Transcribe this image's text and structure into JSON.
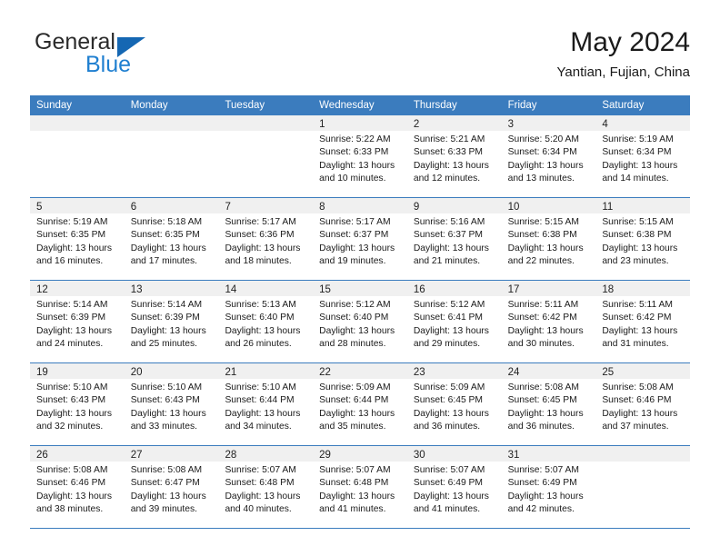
{
  "brand": {
    "name_part1": "General",
    "name_part2": "Blue",
    "logo_icon": "triangle-logo-icon"
  },
  "header": {
    "title": "May 2024",
    "subtitle": "Yantian, Fujian, China"
  },
  "colors": {
    "header_blue": "#3b7cbe",
    "brand_blue": "#1f7fd0",
    "logo_blue": "#1567b3",
    "date_band": "#f0f0f0",
    "text": "#1a1a1a",
    "header_text": "#ffffff"
  },
  "weekdays": [
    "Sunday",
    "Monday",
    "Tuesday",
    "Wednesday",
    "Thursday",
    "Friday",
    "Saturday"
  ],
  "weeks": [
    [
      {
        "date": "",
        "empty": true,
        "sunrise": "",
        "sunset": "",
        "daylight1": "",
        "daylight2": ""
      },
      {
        "date": "",
        "empty": true,
        "sunrise": "",
        "sunset": "",
        "daylight1": "",
        "daylight2": ""
      },
      {
        "date": "",
        "empty": true,
        "sunrise": "",
        "sunset": "",
        "daylight1": "",
        "daylight2": ""
      },
      {
        "date": "1",
        "empty": false,
        "sunrise": "Sunrise: 5:22 AM",
        "sunset": "Sunset: 6:33 PM",
        "daylight1": "Daylight: 13 hours",
        "daylight2": "and 10 minutes."
      },
      {
        "date": "2",
        "empty": false,
        "sunrise": "Sunrise: 5:21 AM",
        "sunset": "Sunset: 6:33 PM",
        "daylight1": "Daylight: 13 hours",
        "daylight2": "and 12 minutes."
      },
      {
        "date": "3",
        "empty": false,
        "sunrise": "Sunrise: 5:20 AM",
        "sunset": "Sunset: 6:34 PM",
        "daylight1": "Daylight: 13 hours",
        "daylight2": "and 13 minutes."
      },
      {
        "date": "4",
        "empty": false,
        "sunrise": "Sunrise: 5:19 AM",
        "sunset": "Sunset: 6:34 PM",
        "daylight1": "Daylight: 13 hours",
        "daylight2": "and 14 minutes."
      }
    ],
    [
      {
        "date": "5",
        "empty": false,
        "sunrise": "Sunrise: 5:19 AM",
        "sunset": "Sunset: 6:35 PM",
        "daylight1": "Daylight: 13 hours",
        "daylight2": "and 16 minutes."
      },
      {
        "date": "6",
        "empty": false,
        "sunrise": "Sunrise: 5:18 AM",
        "sunset": "Sunset: 6:35 PM",
        "daylight1": "Daylight: 13 hours",
        "daylight2": "and 17 minutes."
      },
      {
        "date": "7",
        "empty": false,
        "sunrise": "Sunrise: 5:17 AM",
        "sunset": "Sunset: 6:36 PM",
        "daylight1": "Daylight: 13 hours",
        "daylight2": "and 18 minutes."
      },
      {
        "date": "8",
        "empty": false,
        "sunrise": "Sunrise: 5:17 AM",
        "sunset": "Sunset: 6:37 PM",
        "daylight1": "Daylight: 13 hours",
        "daylight2": "and 19 minutes."
      },
      {
        "date": "9",
        "empty": false,
        "sunrise": "Sunrise: 5:16 AM",
        "sunset": "Sunset: 6:37 PM",
        "daylight1": "Daylight: 13 hours",
        "daylight2": "and 21 minutes."
      },
      {
        "date": "10",
        "empty": false,
        "sunrise": "Sunrise: 5:15 AM",
        "sunset": "Sunset: 6:38 PM",
        "daylight1": "Daylight: 13 hours",
        "daylight2": "and 22 minutes."
      },
      {
        "date": "11",
        "empty": false,
        "sunrise": "Sunrise: 5:15 AM",
        "sunset": "Sunset: 6:38 PM",
        "daylight1": "Daylight: 13 hours",
        "daylight2": "and 23 minutes."
      }
    ],
    [
      {
        "date": "12",
        "empty": false,
        "sunrise": "Sunrise: 5:14 AM",
        "sunset": "Sunset: 6:39 PM",
        "daylight1": "Daylight: 13 hours",
        "daylight2": "and 24 minutes."
      },
      {
        "date": "13",
        "empty": false,
        "sunrise": "Sunrise: 5:14 AM",
        "sunset": "Sunset: 6:39 PM",
        "daylight1": "Daylight: 13 hours",
        "daylight2": "and 25 minutes."
      },
      {
        "date": "14",
        "empty": false,
        "sunrise": "Sunrise: 5:13 AM",
        "sunset": "Sunset: 6:40 PM",
        "daylight1": "Daylight: 13 hours",
        "daylight2": "and 26 minutes."
      },
      {
        "date": "15",
        "empty": false,
        "sunrise": "Sunrise: 5:12 AM",
        "sunset": "Sunset: 6:40 PM",
        "daylight1": "Daylight: 13 hours",
        "daylight2": "and 28 minutes."
      },
      {
        "date": "16",
        "empty": false,
        "sunrise": "Sunrise: 5:12 AM",
        "sunset": "Sunset: 6:41 PM",
        "daylight1": "Daylight: 13 hours",
        "daylight2": "and 29 minutes."
      },
      {
        "date": "17",
        "empty": false,
        "sunrise": "Sunrise: 5:11 AM",
        "sunset": "Sunset: 6:42 PM",
        "daylight1": "Daylight: 13 hours",
        "daylight2": "and 30 minutes."
      },
      {
        "date": "18",
        "empty": false,
        "sunrise": "Sunrise: 5:11 AM",
        "sunset": "Sunset: 6:42 PM",
        "daylight1": "Daylight: 13 hours",
        "daylight2": "and 31 minutes."
      }
    ],
    [
      {
        "date": "19",
        "empty": false,
        "sunrise": "Sunrise: 5:10 AM",
        "sunset": "Sunset: 6:43 PM",
        "daylight1": "Daylight: 13 hours",
        "daylight2": "and 32 minutes."
      },
      {
        "date": "20",
        "empty": false,
        "sunrise": "Sunrise: 5:10 AM",
        "sunset": "Sunset: 6:43 PM",
        "daylight1": "Daylight: 13 hours",
        "daylight2": "and 33 minutes."
      },
      {
        "date": "21",
        "empty": false,
        "sunrise": "Sunrise: 5:10 AM",
        "sunset": "Sunset: 6:44 PM",
        "daylight1": "Daylight: 13 hours",
        "daylight2": "and 34 minutes."
      },
      {
        "date": "22",
        "empty": false,
        "sunrise": "Sunrise: 5:09 AM",
        "sunset": "Sunset: 6:44 PM",
        "daylight1": "Daylight: 13 hours",
        "daylight2": "and 35 minutes."
      },
      {
        "date": "23",
        "empty": false,
        "sunrise": "Sunrise: 5:09 AM",
        "sunset": "Sunset: 6:45 PM",
        "daylight1": "Daylight: 13 hours",
        "daylight2": "and 36 minutes."
      },
      {
        "date": "24",
        "empty": false,
        "sunrise": "Sunrise: 5:08 AM",
        "sunset": "Sunset: 6:45 PM",
        "daylight1": "Daylight: 13 hours",
        "daylight2": "and 36 minutes."
      },
      {
        "date": "25",
        "empty": false,
        "sunrise": "Sunrise: 5:08 AM",
        "sunset": "Sunset: 6:46 PM",
        "daylight1": "Daylight: 13 hours",
        "daylight2": "and 37 minutes."
      }
    ],
    [
      {
        "date": "26",
        "empty": false,
        "sunrise": "Sunrise: 5:08 AM",
        "sunset": "Sunset: 6:46 PM",
        "daylight1": "Daylight: 13 hours",
        "daylight2": "and 38 minutes."
      },
      {
        "date": "27",
        "empty": false,
        "sunrise": "Sunrise: 5:08 AM",
        "sunset": "Sunset: 6:47 PM",
        "daylight1": "Daylight: 13 hours",
        "daylight2": "and 39 minutes."
      },
      {
        "date": "28",
        "empty": false,
        "sunrise": "Sunrise: 5:07 AM",
        "sunset": "Sunset: 6:48 PM",
        "daylight1": "Daylight: 13 hours",
        "daylight2": "and 40 minutes."
      },
      {
        "date": "29",
        "empty": false,
        "sunrise": "Sunrise: 5:07 AM",
        "sunset": "Sunset: 6:48 PM",
        "daylight1": "Daylight: 13 hours",
        "daylight2": "and 41 minutes."
      },
      {
        "date": "30",
        "empty": false,
        "sunrise": "Sunrise: 5:07 AM",
        "sunset": "Sunset: 6:49 PM",
        "daylight1": "Daylight: 13 hours",
        "daylight2": "and 41 minutes."
      },
      {
        "date": "31",
        "empty": false,
        "sunrise": "Sunrise: 5:07 AM",
        "sunset": "Sunset: 6:49 PM",
        "daylight1": "Daylight: 13 hours",
        "daylight2": "and 42 minutes."
      },
      {
        "date": "",
        "empty": true,
        "sunrise": "",
        "sunset": "",
        "daylight1": "",
        "daylight2": ""
      }
    ]
  ]
}
